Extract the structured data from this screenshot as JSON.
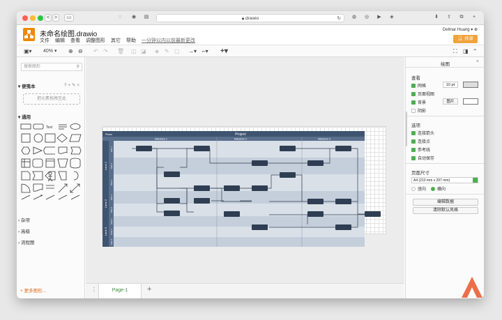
{
  "browser": {
    "url": "drawio",
    "nav": [
      "<",
      ">"
    ]
  },
  "app": {
    "title": "未命名绘图.drawio",
    "menus": [
      "文件",
      "编辑",
      "查看",
      "调整图形",
      "其它",
      "帮助"
    ],
    "save_notice": "一分钟以内以前最新更改",
    "user": "Delmar Huang ▾",
    "share": "共享"
  },
  "toolbar": {
    "zoom": "40%"
  },
  "left": {
    "search_placeholder": "搜索图形",
    "scratchpad_title": "便笺本",
    "scratchpad_hint": "把元素拖拽至此",
    "general": "通用",
    "misc": "杂项",
    "advanced": "高级",
    "flowchart": "流程图",
    "more_shapes": "+ 更多图形...",
    "text_shape": "Text"
  },
  "diagram": {
    "title": "Project",
    "phase_label": "Phase",
    "milestones": [
      "Milestone 1",
      "Milestone 2",
      "Milestone 3"
    ],
    "lanes": [
      "Lane 1",
      "Lane 2",
      "Lane 3"
    ],
    "sublanes": [
      "Role 1",
      "Role 2",
      "Role 3",
      "Role 1",
      "Role 2",
      "Role 1",
      "Role 2",
      "Role 3"
    ],
    "colors": {
      "header": "#3f5470",
      "sub": "#5a6f8c",
      "box": "#2f3e52",
      "row_a": "#d9e0e8",
      "row_b": "#c5cfdb"
    }
  },
  "right": {
    "title": "绘图",
    "view": "查看",
    "grid": "网格",
    "grid_size": "10 pt",
    "page_view": "页面视图",
    "background": "背景",
    "image": "图片",
    "shadow": "阴影",
    "options": "选项",
    "connection_arrows": "连接箭头",
    "connection_points": "连接点",
    "guides": "参考线",
    "autosave": "自动保存",
    "paper_size": "页面尺寸",
    "paper_value": "A4 (210 mm x 297 mm)",
    "portrait": "竖向",
    "landscape": "横向",
    "edit_data": "编辑数据",
    "clear_style": "清除默认风格"
  },
  "pages": {
    "tab": "Page-1",
    "add": "+"
  }
}
